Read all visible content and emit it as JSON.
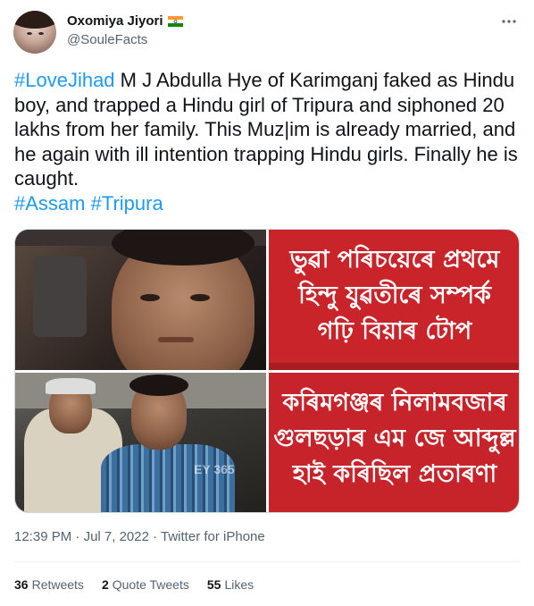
{
  "author": {
    "display_name": "Oxomiya Jiyori",
    "handle": "@SouleFacts",
    "flag_icon": "india-flag-icon"
  },
  "tweet": {
    "hashtag_lovejihad": "#LoveJihad",
    "body": " M J Abdulla Hye of Karimganj faked as Hindu boy, and trapped a Hindu girl of Tripura and siphoned 20 lakhs from her family. This Muz|im is already married, and he again with ill intention trapping Hindu girls. Finally he is caught.",
    "hashtag_assam": "#Assam",
    "hashtag_tripura": "#Tripura"
  },
  "media": {
    "banner_top": [
      "ভুৱা পৰিচয়েৰে প্ৰথমে",
      "হিন্দু যুৱতীৰে সম্পৰ্ক",
      "গঢ়ি বিয়াৰ টোপ"
    ],
    "banner_bottom": [
      "কৰিমগঞ্জৰ নিলামবজাৰ",
      "গুলছড়াৰ এম জে আব্দুল্ল",
      "হাই কৰিছিল প্ৰতাৰণা"
    ],
    "watermark": "EY 365"
  },
  "meta": {
    "time": "12:39 PM",
    "separator": " · ",
    "date": "Jul 7, 2022",
    "source": "Twitter for iPhone"
  },
  "stats": {
    "retweets_count": "36",
    "retweets_label": "Retweets",
    "quotes_count": "2",
    "quotes_label": "Quote Tweets",
    "likes_count": "55",
    "likes_label": "Likes"
  },
  "colors": {
    "hashtag": "#1d9bf0",
    "banner_red": "#c9242a",
    "secondary_text": "#536471"
  }
}
